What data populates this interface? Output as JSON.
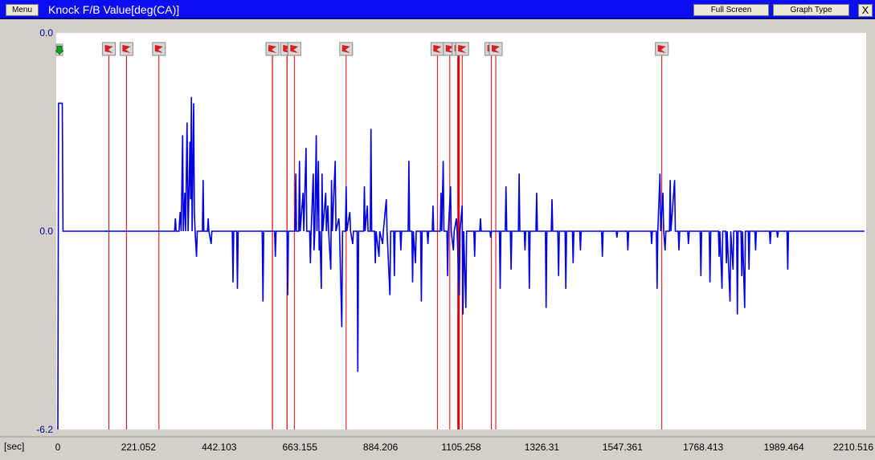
{
  "window": {
    "menu_label": "Menu",
    "title": "Knock F/B Value[deg(CA)]",
    "full_screen_label": "Full Screen",
    "graph_type_label": "Graph Type",
    "close_label": "X"
  },
  "colors": {
    "titlebar": "#0a0ef0",
    "series": "#0000e0",
    "markers": "#e00000",
    "plot_bg": "#ffffff",
    "axis_text": "#0000b0"
  },
  "chart_data": {
    "type": "line",
    "title": "Knock F/B Value[deg(CA)]",
    "xlabel": "[sec]",
    "ylabel": "",
    "xlim": [
      0,
      2210.516
    ],
    "ylim": [
      -6.2,
      0.0
    ],
    "y_ticks": [
      "0.0",
      "0.0",
      "-6.2"
    ],
    "x_ticks": [
      "0",
      "221.052",
      "442.103",
      "663.155",
      "884.206",
      "1105.258",
      "1326.31",
      "1547.361",
      "1768.413",
      "1989.464",
      "2210.516"
    ],
    "grid": false,
    "marker_times": [
      140,
      188,
      277,
      588,
      628,
      648,
      790,
      1040,
      1074,
      1098,
      1108,
      1188,
      1200,
      1655
    ],
    "series": [
      {
        "values": [
          [
            0,
            -6.2
          ],
          [
            2,
            -1.1
          ],
          [
            12,
            -1.1
          ],
          [
            14,
            -3.1
          ],
          [
            320,
            -3.1
          ],
          [
            322,
            -2.9
          ],
          [
            324,
            -3.1
          ],
          [
            332,
            -3.1
          ],
          [
            335,
            -2.8
          ],
          [
            338,
            -3.1
          ],
          [
            342,
            -1.6
          ],
          [
            344,
            -3.1
          ],
          [
            348,
            -2.5
          ],
          [
            350,
            -3.1
          ],
          [
            354,
            -1.4
          ],
          [
            357,
            -3.1
          ],
          [
            360,
            -2.3
          ],
          [
            362,
            -1.7
          ],
          [
            364,
            -2.6
          ],
          [
            366,
            -1.0
          ],
          [
            368,
            -3.1
          ],
          [
            372,
            -1.1
          ],
          [
            374,
            -2.8
          ],
          [
            376,
            -3.1
          ],
          [
            380,
            -3.5
          ],
          [
            382,
            -3.1
          ],
          [
            396,
            -3.1
          ],
          [
            398,
            -2.3
          ],
          [
            400,
            -3.1
          ],
          [
            410,
            -3.1
          ],
          [
            412,
            -2.9
          ],
          [
            414,
            -3.1
          ],
          [
            420,
            -3.3
          ],
          [
            422,
            -3.1
          ],
          [
            478,
            -3.1
          ],
          [
            480,
            -3.9
          ],
          [
            482,
            -3.1
          ],
          [
            490,
            -3.1
          ],
          [
            492,
            -4.0
          ],
          [
            494,
            -3.1
          ],
          [
            560,
            -3.1
          ],
          [
            562,
            -4.2
          ],
          [
            564,
            -3.1
          ],
          [
            594,
            -3.1
          ],
          [
            596,
            -3.5
          ],
          [
            598,
            -3.1
          ],
          [
            628,
            -3.1
          ],
          [
            630,
            -4.1
          ],
          [
            632,
            -3.1
          ],
          [
            650,
            -3.1
          ],
          [
            652,
            -2.2
          ],
          [
            654,
            -3.1
          ],
          [
            660,
            -3.1
          ],
          [
            662,
            -2.0
          ],
          [
            664,
            -3.1
          ],
          [
            672,
            -2.5
          ],
          [
            674,
            -3.1
          ],
          [
            680,
            -1.8
          ],
          [
            682,
            -3.1
          ],
          [
            690,
            -3.1
          ],
          [
            692,
            -3.6
          ],
          [
            694,
            -3.1
          ],
          [
            700,
            -2.2
          ],
          [
            702,
            -3.4
          ],
          [
            704,
            -3.1
          ],
          [
            708,
            -1.6
          ],
          [
            710,
            -3.1
          ],
          [
            714,
            -2.0
          ],
          [
            716,
            -3.4
          ],
          [
            718,
            -3.1
          ],
          [
            722,
            -4.0
          ],
          [
            724,
            -2.2
          ],
          [
            726,
            -3.1
          ],
          [
            734,
            -2.5
          ],
          [
            736,
            -3.1
          ],
          [
            740,
            -2.7
          ],
          [
            742,
            -3.1
          ],
          [
            748,
            -3.7
          ],
          [
            750,
            -2.3
          ],
          [
            752,
            -3.1
          ],
          [
            760,
            -2.0
          ],
          [
            762,
            -3.1
          ],
          [
            770,
            -2.9
          ],
          [
            772,
            -3.1
          ],
          [
            778,
            -4.6
          ],
          [
            780,
            -3.1
          ],
          [
            788,
            -3.1
          ],
          [
            790,
            -2.4
          ],
          [
            792,
            -3.1
          ],
          [
            800,
            -2.8
          ],
          [
            802,
            -3.1
          ],
          [
            808,
            -3.3
          ],
          [
            810,
            -3.1
          ],
          [
            820,
            -3.1
          ],
          [
            822,
            -5.3
          ],
          [
            824,
            -3.1
          ],
          [
            838,
            -3.1
          ],
          [
            840,
            -2.4
          ],
          [
            842,
            -3.1
          ],
          [
            848,
            -2.7
          ],
          [
            850,
            -3.1
          ],
          [
            856,
            -3.1
          ],
          [
            858,
            -1.5
          ],
          [
            860,
            -3.1
          ],
          [
            868,
            -3.1
          ],
          [
            870,
            -3.6
          ],
          [
            872,
            -3.1
          ],
          [
            880,
            -3.5
          ],
          [
            882,
            -3.1
          ],
          [
            890,
            -3.3
          ],
          [
            892,
            -3.1
          ],
          [
            900,
            -2.6
          ],
          [
            902,
            -3.1
          ],
          [
            910,
            -4.1
          ],
          [
            912,
            -3.1
          ],
          [
            920,
            -3.1
          ],
          [
            922,
            -3.8
          ],
          [
            924,
            -3.1
          ],
          [
            938,
            -3.1
          ],
          [
            940,
            -3.4
          ],
          [
            942,
            -3.1
          ],
          [
            960,
            -3.1
          ],
          [
            962,
            -2.0
          ],
          [
            964,
            -3.1
          ],
          [
            970,
            -3.1
          ],
          [
            972,
            -3.9
          ],
          [
            974,
            -3.1
          ],
          [
            980,
            -3.6
          ],
          [
            982,
            -3.1
          ],
          [
            994,
            -3.1
          ],
          [
            996,
            -4.2
          ],
          [
            998,
            -3.1
          ],
          [
            1012,
            -3.1
          ],
          [
            1014,
            -3.3
          ],
          [
            1016,
            -3.1
          ],
          [
            1026,
            -3.1
          ],
          [
            1028,
            -2.7
          ],
          [
            1030,
            -3.1
          ],
          [
            1048,
            -3.1
          ],
          [
            1050,
            -2.5
          ],
          [
            1052,
            -3.1
          ],
          [
            1056,
            -2.0
          ],
          [
            1058,
            -3.1
          ],
          [
            1066,
            -3.1
          ],
          [
            1068,
            -3.8
          ],
          [
            1070,
            -3.1
          ],
          [
            1076,
            -2.4
          ],
          [
            1078,
            -3.1
          ],
          [
            1084,
            -3.4
          ],
          [
            1086,
            -3.1
          ],
          [
            1092,
            -2.9
          ],
          [
            1094,
            -3.1
          ],
          [
            1100,
            -4.1
          ],
          [
            1102,
            -3.1
          ],
          [
            1108,
            -2.7
          ],
          [
            1110,
            -4.4
          ],
          [
            1112,
            -3.1
          ],
          [
            1118,
            -4.3
          ],
          [
            1120,
            -3.1
          ],
          [
            1140,
            -3.1
          ],
          [
            1142,
            -3.5
          ],
          [
            1144,
            -3.1
          ],
          [
            1156,
            -3.1
          ],
          [
            1158,
            -2.9
          ],
          [
            1160,
            -3.1
          ],
          [
            1184,
            -3.1
          ],
          [
            1186,
            -3.2
          ],
          [
            1188,
            -3.1
          ],
          [
            1210,
            -3.1
          ],
          [
            1212,
            -4.0
          ],
          [
            1214,
            -3.1
          ],
          [
            1226,
            -3.1
          ],
          [
            1228,
            -2.4
          ],
          [
            1230,
            -3.1
          ],
          [
            1240,
            -3.1
          ],
          [
            1242,
            -3.7
          ],
          [
            1244,
            -3.1
          ],
          [
            1262,
            -3.1
          ],
          [
            1264,
            -2.2
          ],
          [
            1266,
            -3.1
          ],
          [
            1278,
            -3.1
          ],
          [
            1280,
            -3.4
          ],
          [
            1282,
            -3.1
          ],
          [
            1290,
            -3.1
          ],
          [
            1292,
            -4.0
          ],
          [
            1294,
            -3.1
          ],
          [
            1310,
            -3.1
          ],
          [
            1312,
            -2.5
          ],
          [
            1314,
            -3.1
          ],
          [
            1336,
            -3.1
          ],
          [
            1338,
            -4.3
          ],
          [
            1340,
            -3.1
          ],
          [
            1352,
            -3.1
          ],
          [
            1354,
            -2.6
          ],
          [
            1356,
            -3.1
          ],
          [
            1370,
            -3.1
          ],
          [
            1372,
            -3.8
          ],
          [
            1374,
            -3.1
          ],
          [
            1390,
            -3.1
          ],
          [
            1392,
            -4.0
          ],
          [
            1394,
            -3.1
          ],
          [
            1410,
            -3.1
          ],
          [
            1412,
            -3.6
          ],
          [
            1414,
            -3.1
          ],
          [
            1430,
            -3.1
          ],
          [
            1432,
            -3.4
          ],
          [
            1434,
            -3.1
          ],
          [
            1490,
            -3.1
          ],
          [
            1492,
            -3.5
          ],
          [
            1494,
            -3.1
          ],
          [
            1530,
            -3.1
          ],
          [
            1532,
            -3.2
          ],
          [
            1534,
            -3.1
          ],
          [
            1560,
            -3.1
          ],
          [
            1562,
            -3.4
          ],
          [
            1564,
            -3.1
          ],
          [
            1625,
            -3.1
          ],
          [
            1627,
            -3.3
          ],
          [
            1629,
            -3.1
          ],
          [
            1640,
            -3.1
          ],
          [
            1642,
            -4.0
          ],
          [
            1644,
            -3.1
          ],
          [
            1650,
            -2.2
          ],
          [
            1652,
            -3.1
          ],
          [
            1658,
            -2.5
          ],
          [
            1660,
            -3.1
          ],
          [
            1664,
            -3.4
          ],
          [
            1666,
            -3.1
          ],
          [
            1676,
            -3.1
          ],
          [
            1678,
            -2.3
          ],
          [
            1680,
            -3.1
          ],
          [
            1690,
            -2.3
          ],
          [
            1692,
            -3.1
          ],
          [
            1700,
            -3.1
          ],
          [
            1702,
            -3.4
          ],
          [
            1704,
            -3.1
          ],
          [
            1726,
            -3.1
          ],
          [
            1728,
            -3.3
          ],
          [
            1730,
            -3.1
          ],
          [
            1760,
            -3.1
          ],
          [
            1762,
            -3.8
          ],
          [
            1764,
            -3.1
          ],
          [
            1785,
            -3.1
          ],
          [
            1787,
            -3.9
          ],
          [
            1789,
            -3.1
          ],
          [
            1810,
            -3.1
          ],
          [
            1812,
            -3.5
          ],
          [
            1814,
            -3.1
          ],
          [
            1820,
            -4.0
          ],
          [
            1822,
            -3.1
          ],
          [
            1830,
            -3.1
          ],
          [
            1832,
            -3.6
          ],
          [
            1834,
            -3.1
          ],
          [
            1842,
            -4.2
          ],
          [
            1844,
            -3.1
          ],
          [
            1850,
            -3.7
          ],
          [
            1852,
            -3.1
          ],
          [
            1860,
            -3.1
          ],
          [
            1862,
            -4.4
          ],
          [
            1864,
            -3.1
          ],
          [
            1872,
            -3.1
          ],
          [
            1874,
            -3.8
          ],
          [
            1876,
            -3.1
          ],
          [
            1882,
            -4.3
          ],
          [
            1884,
            -3.1
          ],
          [
            1892,
            -3.1
          ],
          [
            1894,
            -3.7
          ],
          [
            1896,
            -3.1
          ],
          [
            1910,
            -3.1
          ],
          [
            1912,
            -3.4
          ],
          [
            1914,
            -3.1
          ],
          [
            1950,
            -3.1
          ],
          [
            1952,
            -3.3
          ],
          [
            1954,
            -3.1
          ],
          [
            1970,
            -3.1
          ],
          [
            1972,
            -3.2
          ],
          [
            1974,
            -3.1
          ],
          [
            1998,
            -3.1
          ],
          [
            2000,
            -3.7
          ],
          [
            2002,
            -3.1
          ],
          [
            2210,
            -3.1
          ]
        ]
      }
    ]
  }
}
